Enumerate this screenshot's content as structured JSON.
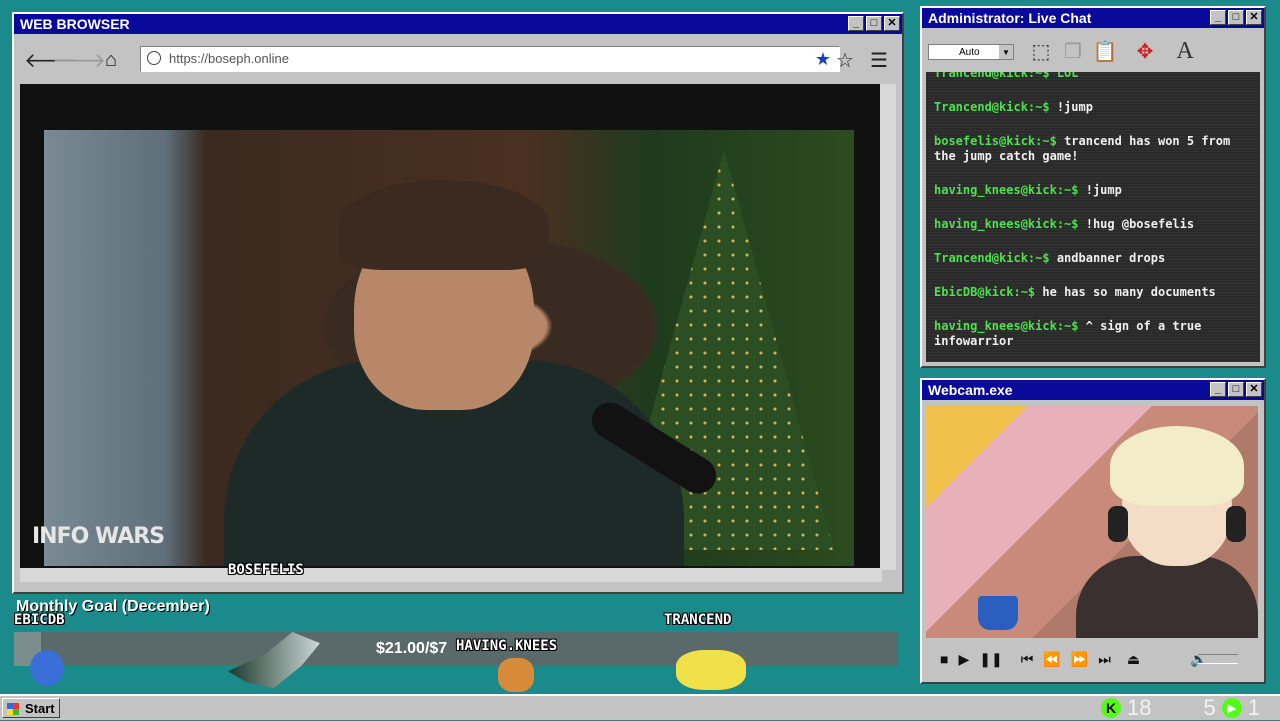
{
  "browser": {
    "title": "WEB BROWSER",
    "url": "https://boseph.online"
  },
  "chat": {
    "title": "Administrator: Live Chat",
    "font_select": "Auto",
    "top_partial": "Trancend@kick:~$ LOL",
    "messages": [
      {
        "user": "Trancend@kick:~$",
        "text": "!jump"
      },
      {
        "user": "bosefelis@kick:~$",
        "text": "trancend has won 5 from the jump catch game!"
      },
      {
        "user": "having_knees@kick:~$",
        "text": "!jump"
      },
      {
        "user": "having_knees@kick:~$",
        "text": "!hug @bosefelis"
      },
      {
        "user": "Trancend@kick:~$",
        "text": "andbanner drops"
      },
      {
        "user": "EbicDB@kick:~$",
        "text": "he has so many documents"
      },
      {
        "user": "having_knees@kick:~$",
        "text": "^ sign of a true infowarrior"
      }
    ]
  },
  "webcam": {
    "title": "Webcam.exe"
  },
  "overlay": {
    "infowars_logo": "INFO WARS",
    "goal_title": "Monthly Goal (December)",
    "goal_amount": "$21.00/$7",
    "goal_progress_fraction": 0.03,
    "names": {
      "bosefelis": "BOSEFELIS",
      "ebicdb": "EBICDB",
      "having_knees": "HAVING.KNEES",
      "trancend": "TRANCEND"
    }
  },
  "taskbar": {
    "start_label": "Start",
    "viewer_count": "18",
    "follower_count": "5",
    "extra_count": "1"
  },
  "colors": {
    "desktop": "#1a8a8a",
    "titlebar": "#0a0a9a",
    "chat_user": "#4fe04f",
    "kick_green": "#53fc18"
  }
}
